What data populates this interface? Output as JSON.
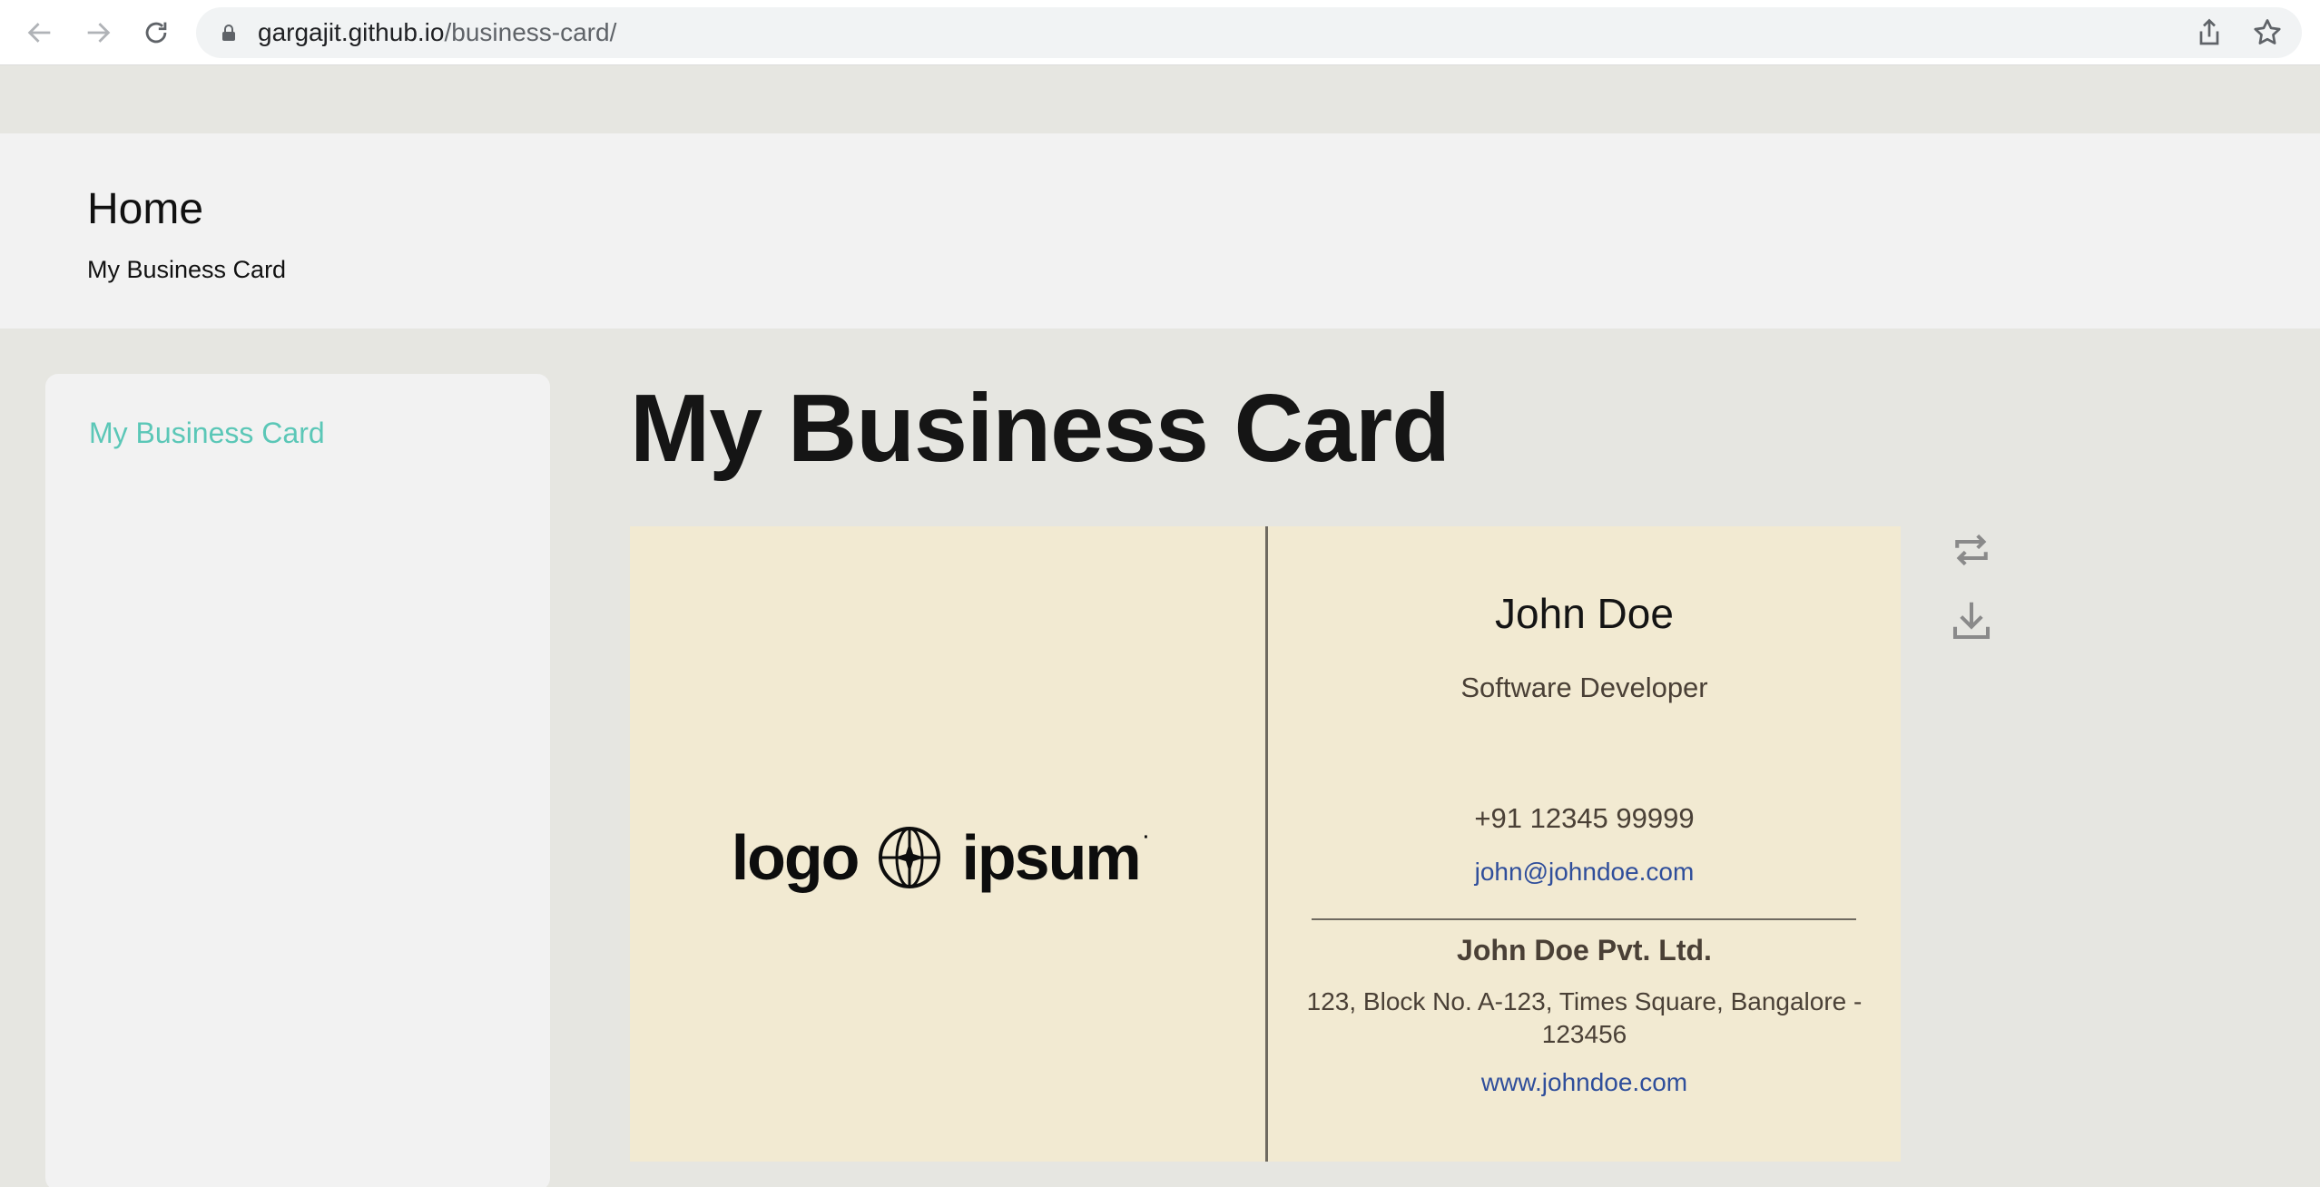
{
  "browser": {
    "url_domain": "gargajit.github.io",
    "url_path": "/business-card/",
    "icons": [
      "back-arrow-icon",
      "forward-arrow-icon",
      "reload-icon",
      "lock-icon",
      "share-icon",
      "star-icon"
    ]
  },
  "header": {
    "home_label": "Home",
    "subtitle": "My Business Card"
  },
  "sidebar": {
    "items": [
      {
        "label": "My Business Card"
      }
    ]
  },
  "main": {
    "title": "My Business Card",
    "card": {
      "logo_text_left": "logo",
      "logo_text_right": "ipsum",
      "name": "John Doe",
      "role": "Software Developer",
      "phone": "+91 12345 99999",
      "email": "john@johndoe.com",
      "company": "John Doe Pvt. Ltd.",
      "address": "123, Block No. A-123, Times Square, Bangalore - 123456",
      "website": "www.johndoe.com"
    },
    "actions": [
      "flip-icon",
      "download-icon"
    ]
  },
  "colors": {
    "accent": "#5bc7b7",
    "card_bg": "#f2ead2",
    "link": "#2f4e9b",
    "page_bg": "#e6e6e1"
  }
}
